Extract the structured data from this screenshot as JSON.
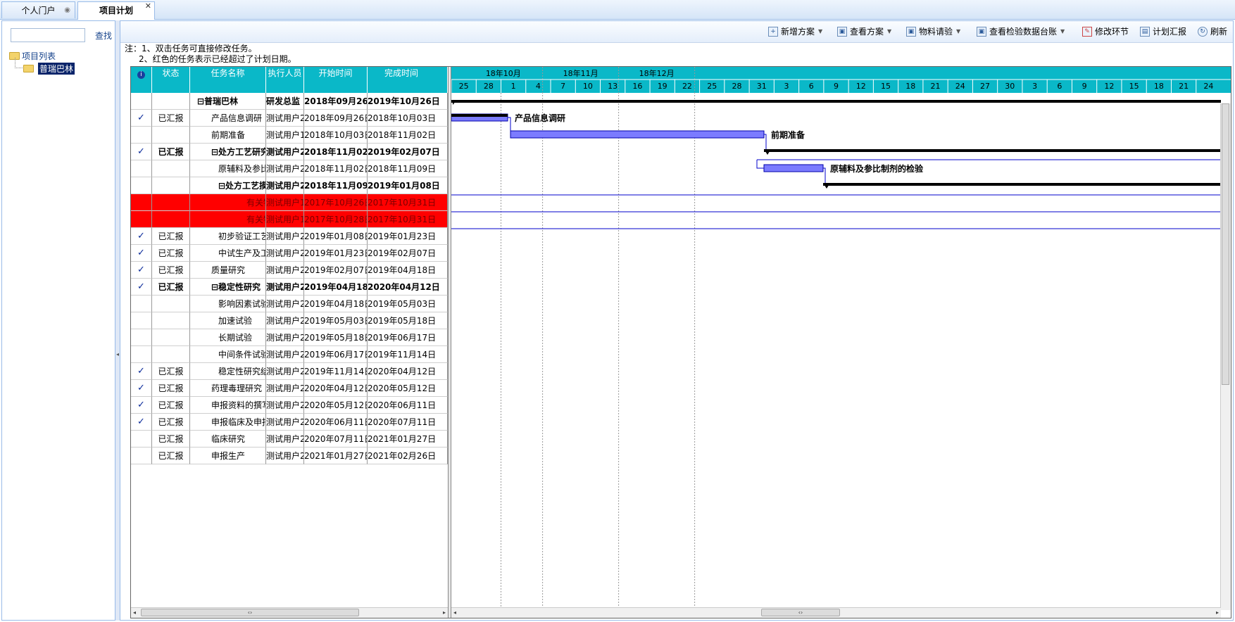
{
  "tabs": [
    {
      "label": "个人门户"
    },
    {
      "label": "项目计划"
    }
  ],
  "sidebar": {
    "search_placeholder": "",
    "search_label": "查找",
    "tree_root": "项目列表",
    "tree_child": "普瑞巴林"
  },
  "toolbar": {
    "add_plan": "新增方案",
    "view_plan": "查看方案",
    "material_request": "物料请验",
    "view_inspection": "查看检验数据台账",
    "modify_step": "修改环节",
    "plan_report": "计划汇报",
    "refresh": "刷新"
  },
  "notes": {
    "line1": "注：1、双击任务可直接修改任务。",
    "line2": "2、红色的任务表示已经超过了计划日期。"
  },
  "grid": {
    "headers": {
      "info": "i",
      "status": "状态",
      "name": "任务名称",
      "owner": "执行人员",
      "start": "开始时间",
      "end": "完成时间"
    },
    "rows": [
      {
        "check": "",
        "status": "",
        "name": "⊟普瑞巴林",
        "owner": "研发总监",
        "start": "2018年09月26日",
        "end": "2019年10月26日",
        "bold": true,
        "red": false,
        "indent": 1
      },
      {
        "check": "✓",
        "status": "已汇报",
        "name": "产品信息调研",
        "owner": "测试用户2",
        "start": "2018年09月26日",
        "end": "2018年10月03日",
        "bold": false,
        "red": false,
        "indent": 2
      },
      {
        "check": "",
        "status": "",
        "name": "前期准备",
        "owner": "测试用户1",
        "start": "2018年10月03日",
        "end": "2018年11月02日",
        "bold": false,
        "red": false,
        "indent": 2
      },
      {
        "check": "✓",
        "status": "已汇报",
        "name": "⊟处方工艺研究",
        "owner": "测试用户2",
        "start": "2018年11月02日",
        "end": "2019年02月07日",
        "bold": true,
        "red": false,
        "indent": 2
      },
      {
        "check": "",
        "status": "",
        "name": "原辅料及参比",
        "owner": "测试用户2",
        "start": "2018年11月02日",
        "end": "2018年11月09日",
        "bold": false,
        "red": false,
        "indent": 3
      },
      {
        "check": "",
        "status": "",
        "name": "⊟处方工艺摸索",
        "owner": "测试用户2",
        "start": "2018年11月09日",
        "end": "2019年01月08日",
        "bold": true,
        "red": false,
        "indent": 3
      },
      {
        "check": "",
        "status": "",
        "name": "有关物质的",
        "owner": "测试用户1",
        "start": "2017年10月26日",
        "end": "2017年10月31日",
        "bold": false,
        "red": true,
        "indent": 4
      },
      {
        "check": "",
        "status": "",
        "name": "有关物质的",
        "owner": "测试用户1",
        "start": "2017年10月28日",
        "end": "2017年10月31日",
        "bold": false,
        "red": true,
        "indent": 4
      },
      {
        "check": "✓",
        "status": "已汇报",
        "name": "初步验证工艺",
        "owner": "测试用户2",
        "start": "2019年01月08日",
        "end": "2019年01月23日",
        "bold": false,
        "red": false,
        "indent": 3
      },
      {
        "check": "✓",
        "status": "已汇报",
        "name": "中试生产及工",
        "owner": "测试用户2",
        "start": "2019年01月23日",
        "end": "2019年02月07日",
        "bold": false,
        "red": false,
        "indent": 3
      },
      {
        "check": "✓",
        "status": "已汇报",
        "name": "质量研究",
        "owner": "测试用户2",
        "start": "2019年02月07日",
        "end": "2019年04月18日",
        "bold": false,
        "red": false,
        "indent": 2
      },
      {
        "check": "✓",
        "status": "已汇报",
        "name": "⊟稳定性研究",
        "owner": "测试用户2",
        "start": "2019年04月18日",
        "end": "2020年04月12日",
        "bold": true,
        "red": false,
        "indent": 2
      },
      {
        "check": "",
        "status": "",
        "name": "影响因素试验",
        "owner": "测试用户2",
        "start": "2019年04月18日",
        "end": "2019年05月03日",
        "bold": false,
        "red": false,
        "indent": 3
      },
      {
        "check": "",
        "status": "",
        "name": "加速试验",
        "owner": "测试用户2",
        "start": "2019年05月03日",
        "end": "2019年05月18日",
        "bold": false,
        "red": false,
        "indent": 3
      },
      {
        "check": "",
        "status": "",
        "name": "长期试验",
        "owner": "测试用户2",
        "start": "2019年05月18日",
        "end": "2019年06月17日",
        "bold": false,
        "red": false,
        "indent": 3
      },
      {
        "check": "",
        "status": "",
        "name": "中间条件试验",
        "owner": "测试用户2",
        "start": "2019年06月17日",
        "end": "2019年11月14日",
        "bold": false,
        "red": false,
        "indent": 3
      },
      {
        "check": "✓",
        "status": "已汇报",
        "name": "稳定性研究结",
        "owner": "测试用户2",
        "start": "2019年11月14日",
        "end": "2020年04月12日",
        "bold": false,
        "red": false,
        "indent": 3
      },
      {
        "check": "✓",
        "status": "已汇报",
        "name": "药理毒理研究",
        "owner": "测试用户2",
        "start": "2020年04月12日",
        "end": "2020年05月12日",
        "bold": false,
        "red": false,
        "indent": 2
      },
      {
        "check": "✓",
        "status": "已汇报",
        "name": "申报资料的撰写",
        "owner": "测试用户2",
        "start": "2020年05月12日",
        "end": "2020年06月11日",
        "bold": false,
        "red": false,
        "indent": 2
      },
      {
        "check": "✓",
        "status": "已汇报",
        "name": "申报临床及申报",
        "owner": "测试用户2",
        "start": "2020年06月11日",
        "end": "2020年07月11日",
        "bold": false,
        "red": false,
        "indent": 2
      },
      {
        "check": "",
        "status": "已汇报",
        "name": "临床研究",
        "owner": "测试用户2",
        "start": "2020年07月11日",
        "end": "2021年01月27日",
        "bold": false,
        "red": false,
        "indent": 2
      },
      {
        "check": "",
        "status": "已汇报",
        "name": "申报生产",
        "owner": "测试用户2",
        "start": "2021年01月27日",
        "end": "2021年02月26日",
        "bold": false,
        "red": false,
        "indent": 2
      }
    ]
  },
  "timeline": {
    "months": [
      "18年10月",
      "18年11月",
      "18年12月"
    ],
    "days": [
      "25",
      "28",
      "1",
      "4",
      "7",
      "10",
      "13",
      "16",
      "19",
      "22",
      "25",
      "28",
      "31",
      "3",
      "6",
      "9",
      "12",
      "15",
      "18",
      "21",
      "24",
      "27",
      "30",
      "3",
      "6",
      "9",
      "12",
      "15",
      "18",
      "21",
      "24"
    ],
    "bar_labels": {
      "r1": "产品信息调研",
      "r2": "前期准备",
      "r4": "原辅料及参比制剂的检验"
    },
    "colors": {
      "header": "#0ab8c8",
      "task_bar": "#7b7bff",
      "summary": "#000000",
      "link": "#0000cc",
      "overdue": "#ff0000"
    }
  }
}
